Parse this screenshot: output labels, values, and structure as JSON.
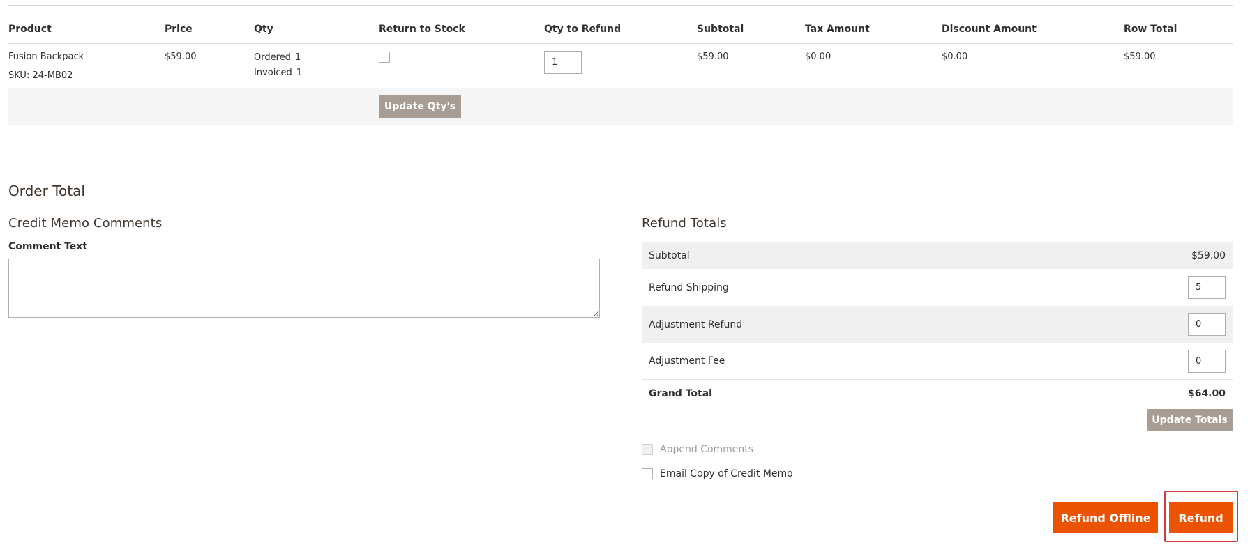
{
  "items_table": {
    "headers": {
      "product": "Product",
      "price": "Price",
      "qty": "Qty",
      "return_to_stock": "Return to Stock",
      "qty_to_refund": "Qty to Refund",
      "subtotal": "Subtotal",
      "tax_amount": "Tax Amount",
      "discount_amount": "Discount Amount",
      "row_total": "Row Total"
    },
    "rows": [
      {
        "product_name": "Fusion Backpack",
        "sku": "SKU: 24-MB02",
        "price": "$59.00",
        "ordered_label": "Ordered",
        "ordered_qty": "1",
        "invoiced_label": "Invoiced",
        "invoiced_qty": "1",
        "return_to_stock_checked": false,
        "qty_to_refund": "1",
        "subtotal": "$59.00",
        "tax_amount": "$0.00",
        "discount_amount": "$0.00",
        "row_total": "$59.00"
      }
    ],
    "update_qty_label": "Update Qty's"
  },
  "order_total": {
    "title": "Order Total"
  },
  "comments": {
    "title": "Credit Memo Comments",
    "comment_label": "Comment Text",
    "comment_value": ""
  },
  "refund_totals": {
    "title": "Refund Totals",
    "subtotal_label": "Subtotal",
    "subtotal_value": "$59.00",
    "refund_shipping_label": "Refund Shipping",
    "refund_shipping_value": "5",
    "adjustment_refund_label": "Adjustment Refund",
    "adjustment_refund_value": "0",
    "adjustment_fee_label": "Adjustment Fee",
    "adjustment_fee_value": "0",
    "grand_total_label": "Grand Total",
    "grand_total_value": "$64.00",
    "update_totals_label": "Update Totals"
  },
  "options": {
    "append_comments_label": "Append Comments",
    "email_copy_label": "Email Copy of Credit Memo"
  },
  "actions": {
    "refund_offline_label": "Refund Offline",
    "refund_label": "Refund"
  },
  "colors": {
    "accent_orange": "#eb5202",
    "button_gray": "#a79d95",
    "highlight_red": "#d43a3a"
  }
}
